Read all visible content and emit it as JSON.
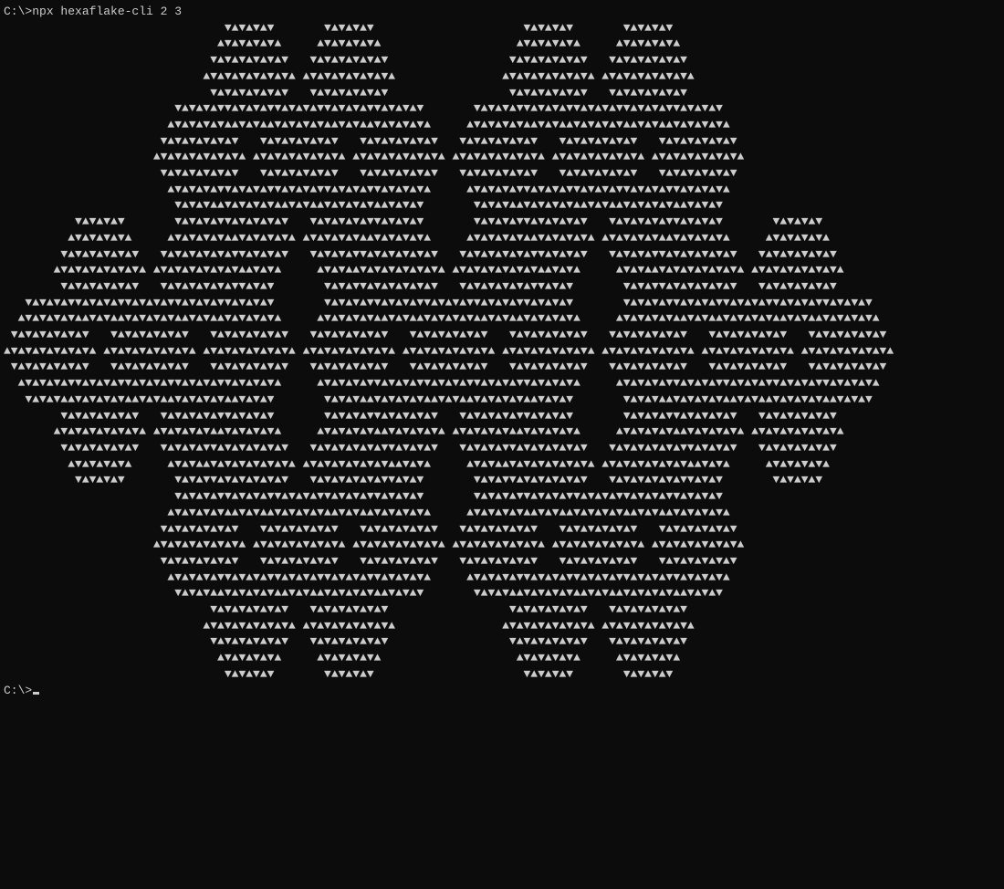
{
  "prompt1": "C:\\>",
  "command": "npx hexaflake-cli 2 3",
  "prompt2": "C:\\>",
  "hexaflake": {
    "size": 2,
    "iterations": 3,
    "glyphs": {
      "up": "▲",
      "down": "▼",
      "space": " "
    }
  }
}
